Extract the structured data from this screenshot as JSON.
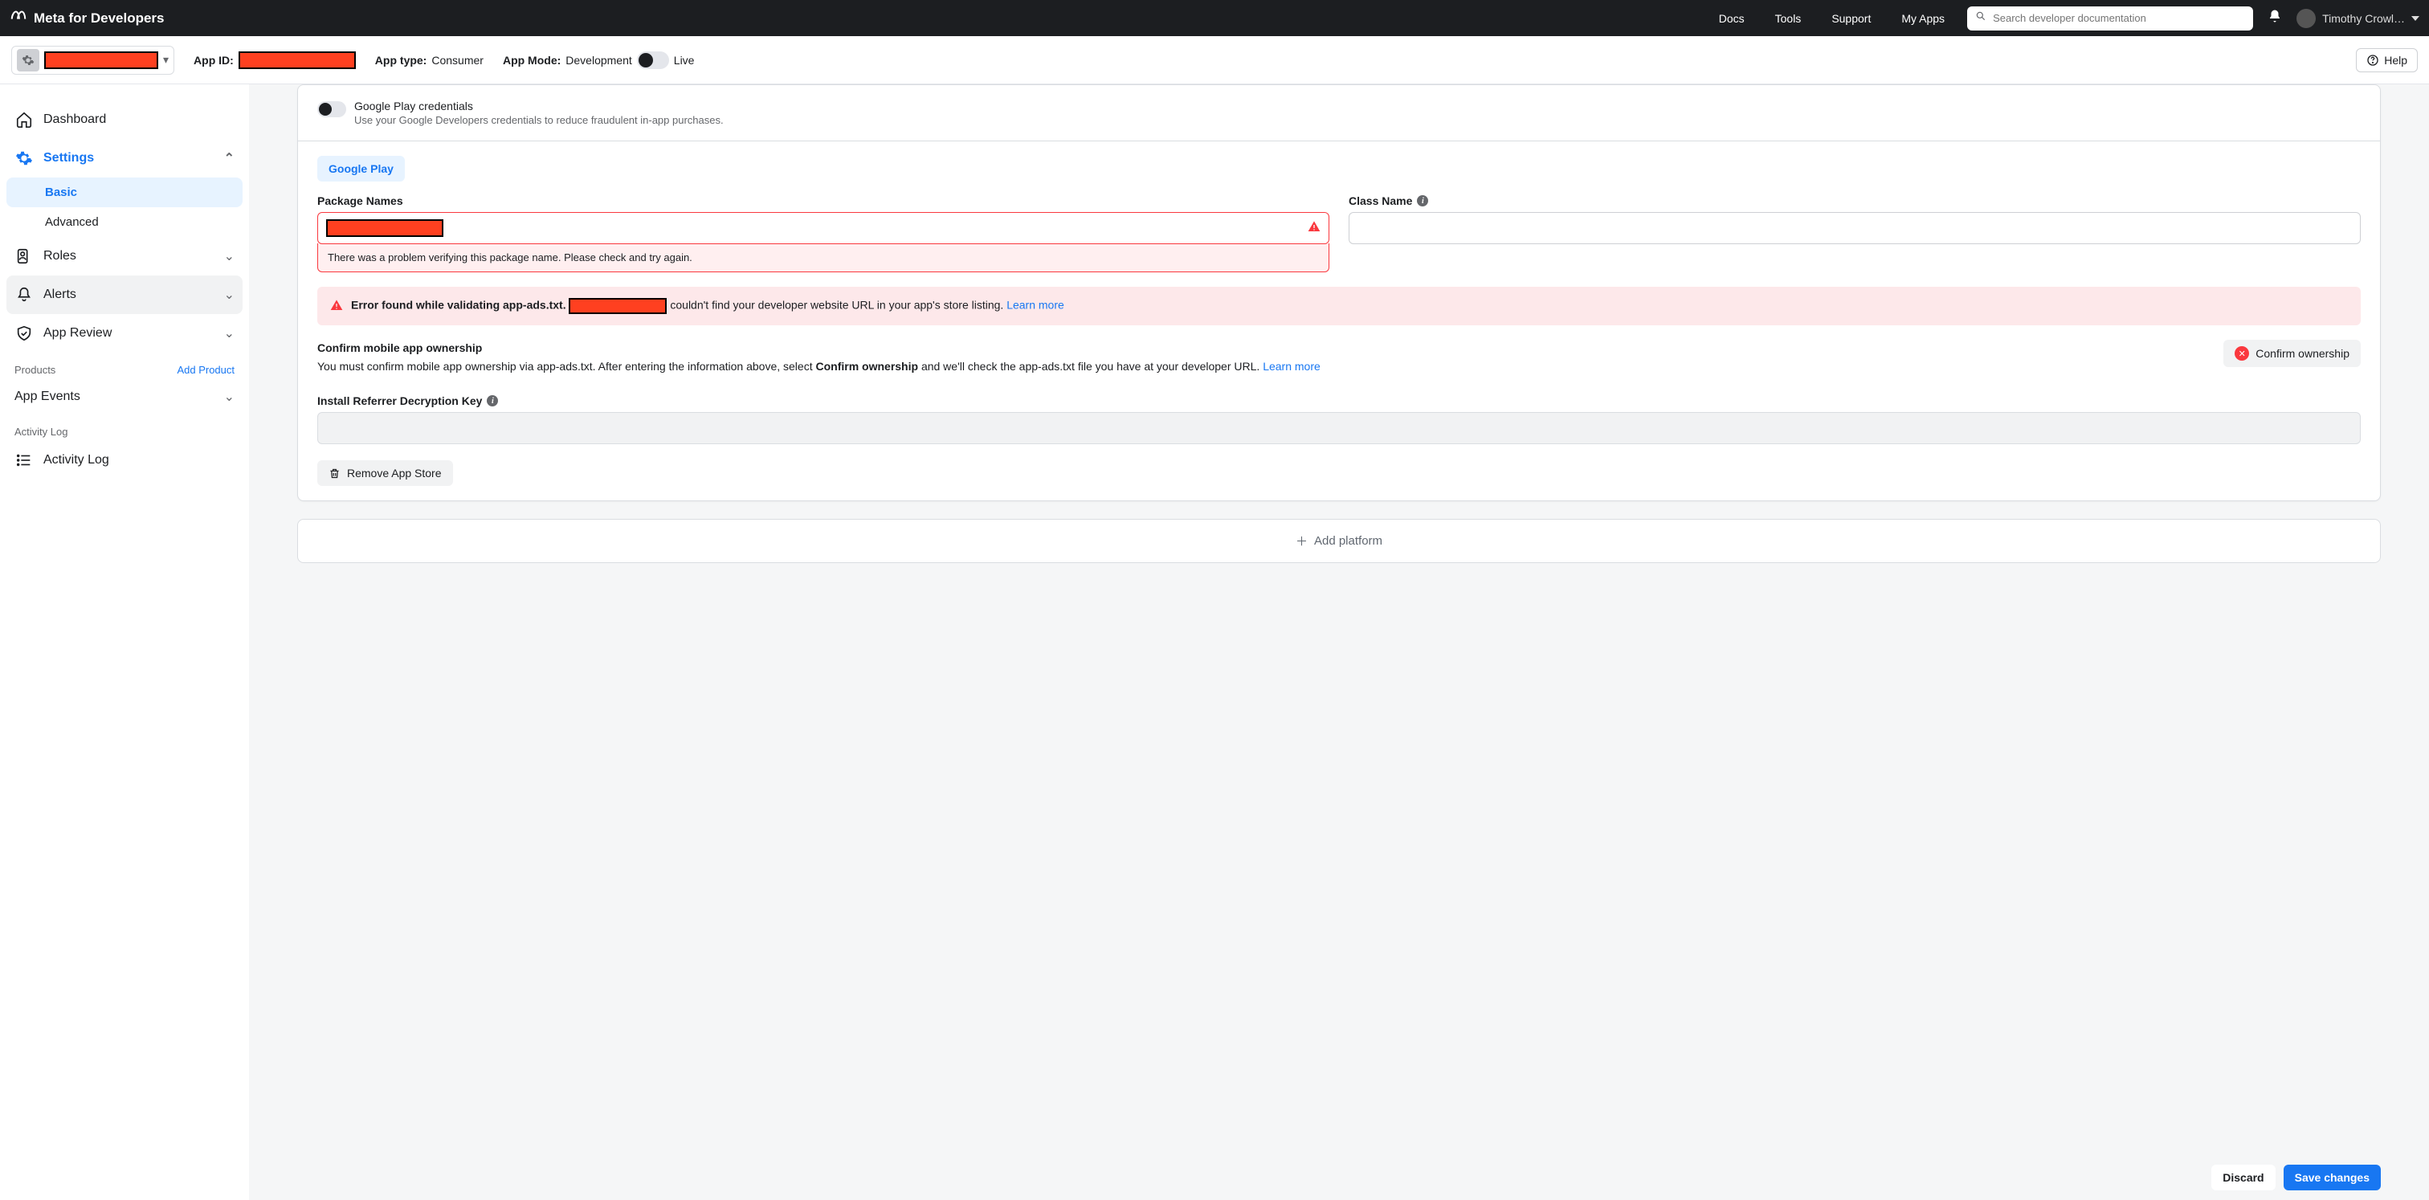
{
  "header": {
    "brand": "Meta for Developers",
    "nav": {
      "docs": "Docs",
      "tools": "Tools",
      "support": "Support",
      "myapps": "My Apps"
    },
    "search_placeholder": "Search developer documentation",
    "user_name": "Timothy Crowl…"
  },
  "appbar": {
    "app_id_label": "App ID:",
    "app_type_label": "App type:",
    "app_type_value": "Consumer",
    "app_mode_label": "App Mode:",
    "app_mode_value": "Development",
    "live_label": "Live",
    "help_label": "Help"
  },
  "sidebar": {
    "dashboard": "Dashboard",
    "settings": "Settings",
    "basic": "Basic",
    "advanced": "Advanced",
    "roles": "Roles",
    "alerts": "Alerts",
    "app_review": "App Review",
    "products_heading": "Products",
    "add_product": "Add Product",
    "app_events": "App Events",
    "activity_log_heading": "Activity Log",
    "activity_log": "Activity Log"
  },
  "main": {
    "gplay_title": "Google Play credentials",
    "gplay_desc": "Use your Google Developers credentials to reduce fraudulent in-app purchases.",
    "tab_google_play": "Google Play",
    "package_names_label": "Package Names",
    "class_name_label": "Class Name",
    "package_error": "There was a problem verifying this package name. Please check and try again.",
    "banner_prefix": "Error found while validating app-ads.txt.",
    "banner_suffix": " couldn't find your developer website URL in your app's store listing. ",
    "learn_more": "Learn more",
    "confirm_heading": "Confirm mobile app ownership",
    "confirm_body_1": "You must confirm mobile app ownership via app-ads.txt. After entering the information above, select ",
    "confirm_body_strong": "Confirm ownership",
    "confirm_body_2": " and we'll check the app-ads.txt file you have at your developer URL. ",
    "confirm_btn": "Confirm ownership",
    "install_referrer_label": "Install Referrer Decryption Key",
    "remove_btn": "Remove App Store",
    "add_platform": "Add platform"
  },
  "footer": {
    "discard": "Discard",
    "save": "Save changes"
  }
}
